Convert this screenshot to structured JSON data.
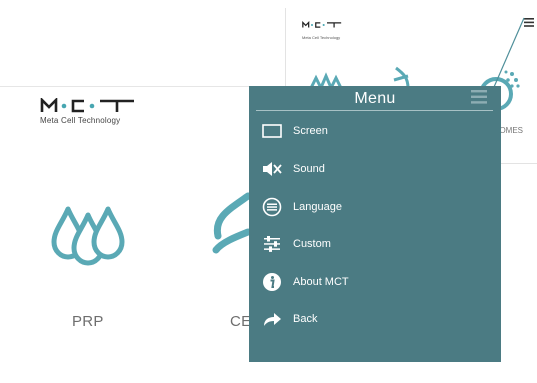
{
  "app": {
    "logo_text": "M·C·T",
    "logo_subtitle": "Meta Cell Technology"
  },
  "tiles": [
    {
      "label": "PRP",
      "icon": "drops-icon"
    },
    {
      "label": "CE",
      "icon": "dna-icon"
    }
  ],
  "inset": {
    "logo_subtitle": "Meta Cell Technology",
    "tile_label_partial": "OMES",
    "icon": "hamburger-icon"
  },
  "menu": {
    "title": "Menu",
    "items": [
      {
        "label": "Screen",
        "icon": "screen-icon"
      },
      {
        "label": "Sound",
        "icon": "sound-muted-icon"
      },
      {
        "label": "Language",
        "icon": "language-icon"
      },
      {
        "label": "Custom",
        "icon": "sliders-icon"
      },
      {
        "label": "About MCT",
        "icon": "info-icon"
      },
      {
        "label": "Back",
        "icon": "back-arrow-icon"
      }
    ]
  },
  "colors": {
    "menu_bg": "#4b7b83",
    "accent_teal": "#5aa9b5",
    "logo_dark": "#222222",
    "logo_teal": "#47a6b1"
  }
}
